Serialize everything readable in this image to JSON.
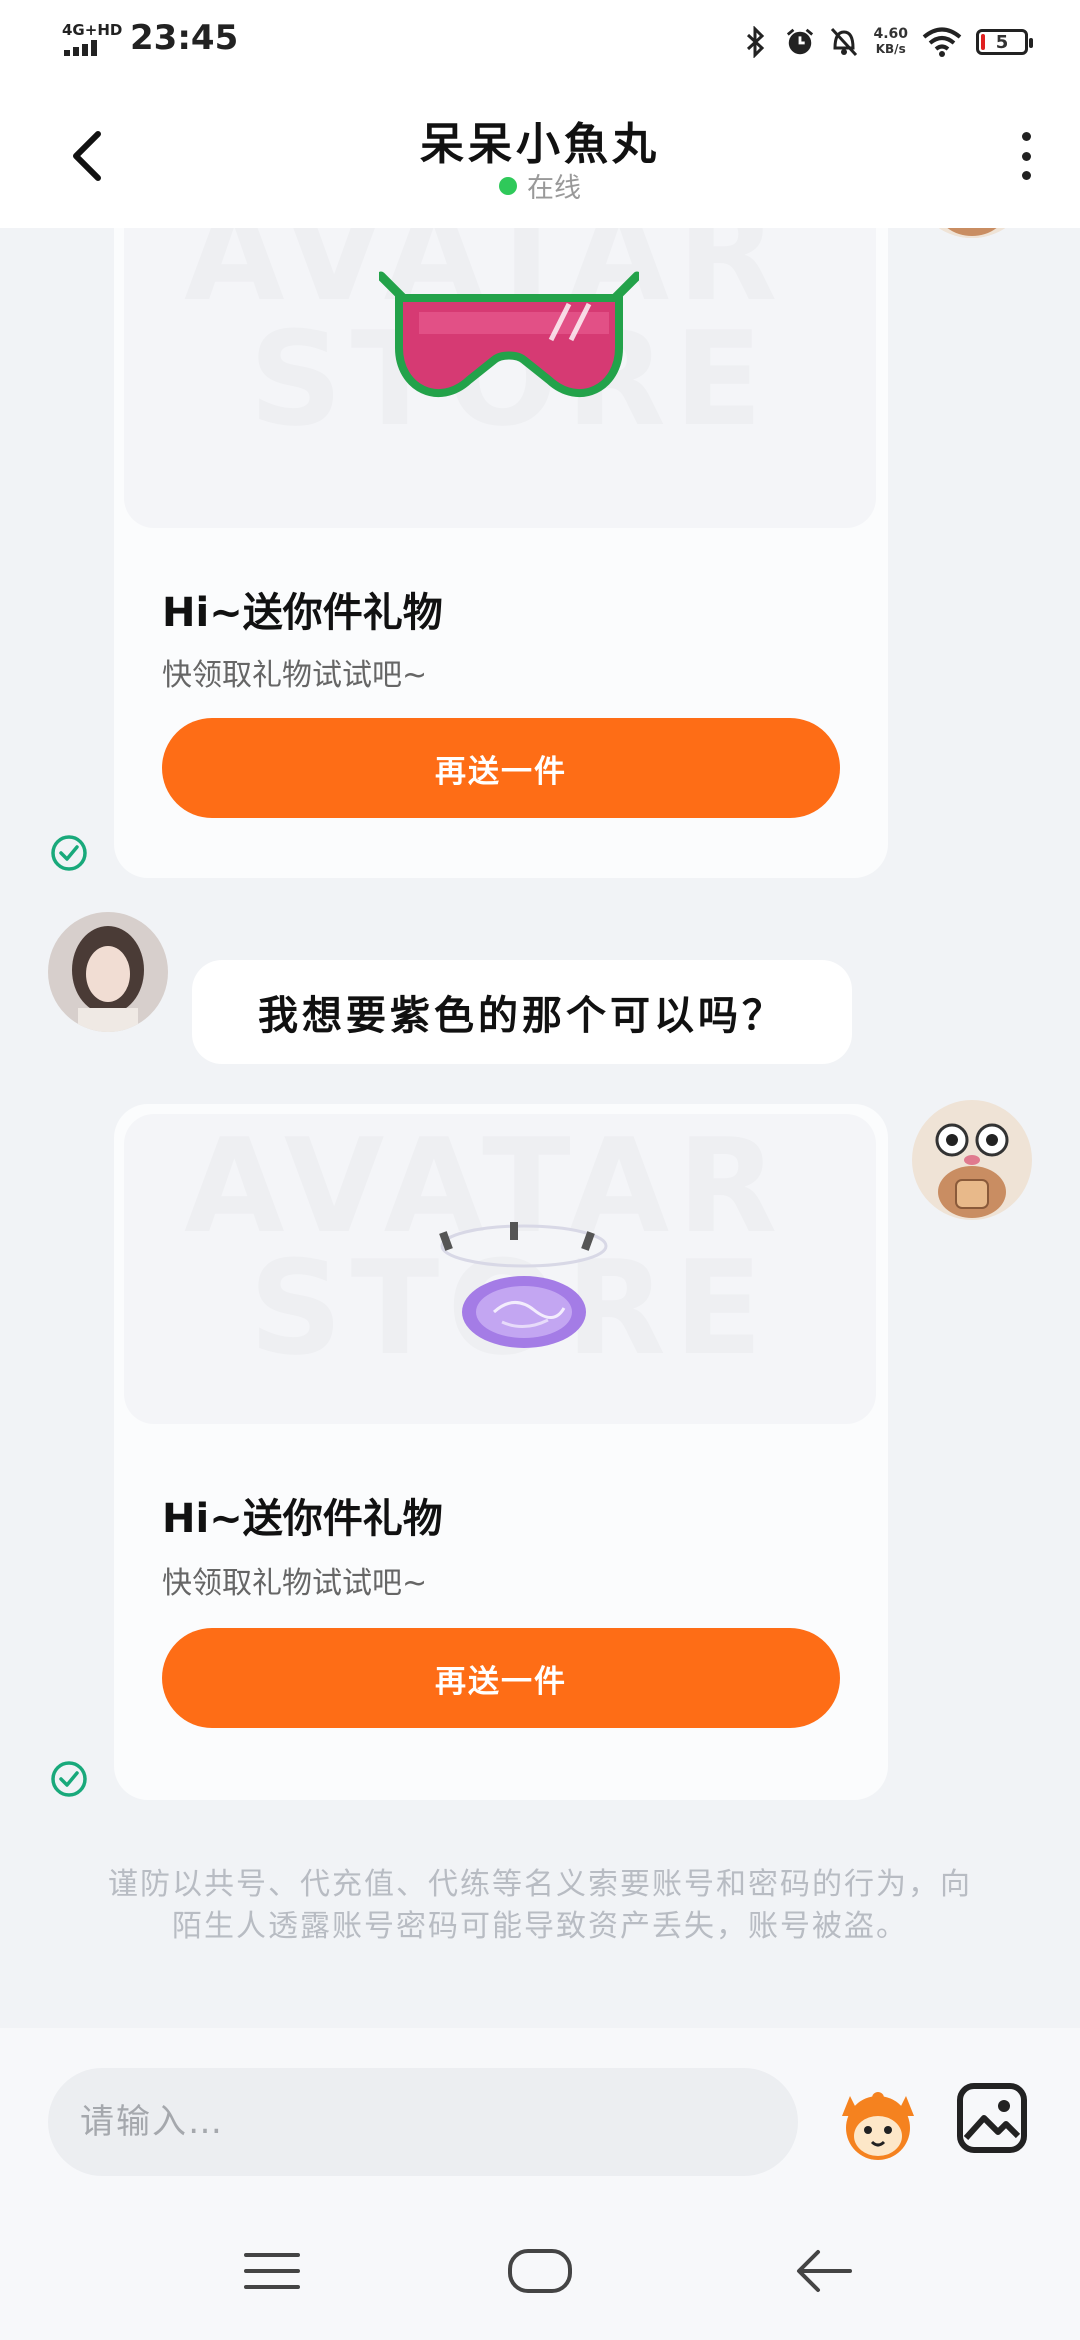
{
  "status_bar": {
    "network": "4G+HD",
    "time": "23:45",
    "speed_value": "4.60",
    "speed_unit": "KB/s",
    "battery": "5"
  },
  "header": {
    "title": "呆呆小魚丸",
    "status": "在线"
  },
  "messages": [
    {
      "type": "gift_card",
      "title": "Hi~送你件礼物",
      "subtitle": "快领取礼物试试吧~",
      "button": "再送一件",
      "watermark_line1": "AVATAR",
      "watermark_line2": "STORE",
      "item_icon": "sunglasses-icon"
    },
    {
      "type": "text",
      "text": "我想要紫色的那个可以吗？"
    },
    {
      "type": "gift_card",
      "title": "Hi~送你件礼物",
      "subtitle": "快领取礼物试试吧~",
      "button": "再送一件",
      "watermark_line1": "AVATAR",
      "watermark_line2": "STORE",
      "item_icon": "purple-halo-icon"
    }
  ],
  "warning": "谨防以共号、代充值、代练等名义索要账号和密码的行为，向陌生人透露账号密码可能导致资产丢失，账号被盗。",
  "input": {
    "placeholder": "请输入…"
  },
  "colors": {
    "accent": "#fe6d16",
    "online": "#2fc95a",
    "check": "#19a97b"
  }
}
